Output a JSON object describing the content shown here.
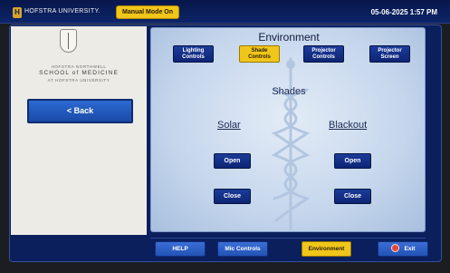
{
  "header": {
    "logo_letter": "H",
    "university": "HOFSTRA UNIVERSITY.",
    "manual_mode": "Manual Mode On",
    "datetime": "05-06-2025 1:57 PM"
  },
  "school": {
    "line1": "HOFSTRA NORTHWELL",
    "line2": "SCHOOL of MEDICINE",
    "line3": "AT HOFSTRA UNIVERSITY"
  },
  "back_label": "< Back",
  "panel": {
    "title": "Environment",
    "tabs": [
      {
        "line1": "Lighting",
        "line2": "Controls",
        "active": false
      },
      {
        "line1": "Shade",
        "line2": "Controls",
        "active": true
      },
      {
        "line1": "Projector",
        "line2": "Controls",
        "active": false
      },
      {
        "line1": "Projector",
        "line2": "Screen",
        "active": false
      }
    ],
    "heading": "Shades",
    "solar": {
      "title": "Solar",
      "open": "Open",
      "close": "Close"
    },
    "blackout": {
      "title": "Blackout",
      "open": "Open",
      "close": "Close"
    }
  },
  "footer": {
    "help": "HELP",
    "mic": "Mic Controls",
    "environment": "Environment",
    "exit": "Exit"
  },
  "colors": {
    "accent_yellow": "#f1c61b",
    "button_blue": "#0d2474",
    "frame_navy": "#0b1f5d"
  }
}
